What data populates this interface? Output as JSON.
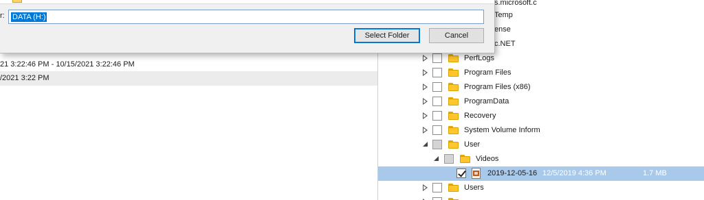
{
  "dialog": {
    "folder_label": "r:",
    "folder_value": "DATA (H:)",
    "select_button": "Select Folder",
    "cancel_button": "Cancel"
  },
  "left_pane": {
    "rows": [
      "21 3:22:46 PM - 10/15/2021 3:22:46 PM",
      "/2021 3:22 PM"
    ]
  },
  "tree": {
    "partial_top_items": [
      "s.microsoft.c",
      "Temp",
      "ense",
      "c.NET"
    ],
    "items": [
      {
        "label": "PerfLogs"
      },
      {
        "label": "Program Files"
      },
      {
        "label": "Program Files (x86)"
      },
      {
        "label": "ProgramData"
      },
      {
        "label": "Recovery"
      },
      {
        "label": "System Volume Inform"
      },
      {
        "label": "User"
      },
      {
        "label": "Videos"
      },
      {
        "label": "2019-12-05-16",
        "date": "12/5/2019 4:36 PM",
        "size": "1.7 MB"
      },
      {
        "label": "Users"
      }
    ]
  },
  "colors": {
    "selection_bg": "#a9c9ea",
    "accent_blue": "#0078d7",
    "folder_yellow": "#ffc72c"
  }
}
